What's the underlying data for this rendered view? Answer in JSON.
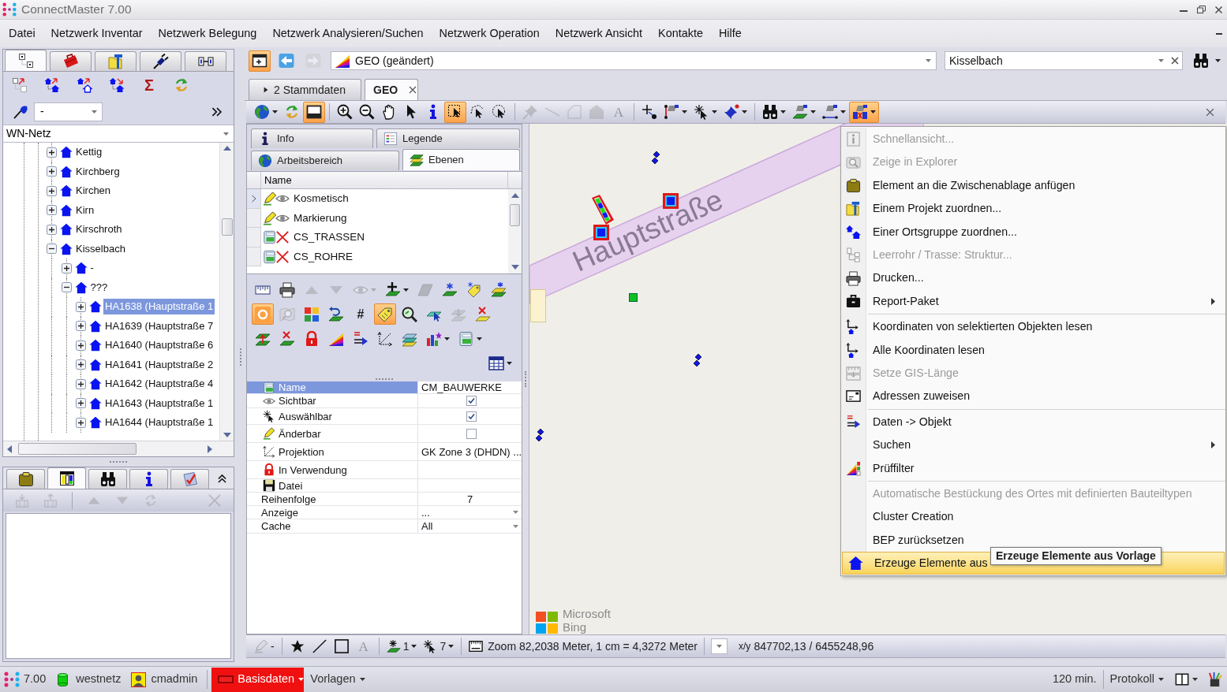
{
  "window": {
    "title": "ConnectMaster 7.00"
  },
  "menu_bar": [
    "Datei",
    "Netzwerk Inventar",
    "Netzwerk Belegung",
    "Netzwerk Analysieren/Suchen",
    "Netzwerk Operation",
    "Netzwerk Ansicht",
    "Kontakte",
    "Hilfe"
  ],
  "left_panel": {
    "tabs": [
      {
        "kind": "tree",
        "selected": true
      },
      {
        "kind": "toolbox",
        "selected": false
      },
      {
        "kind": "project",
        "selected": false
      },
      {
        "kind": "plug",
        "selected": false
      },
      {
        "kind": "connector",
        "selected": false
      }
    ],
    "toolbar": [
      {
        "kind": "treearrow"
      },
      {
        "kind": "housesup"
      },
      {
        "kind": "houseout"
      },
      {
        "kind": "housesdown"
      },
      {
        "kind": "sigma",
        "label": "Σ"
      },
      {
        "kind": "refresh"
      }
    ],
    "filter": {
      "value": "-"
    },
    "network": {
      "value": "WN-Netz"
    },
    "tree": [
      {
        "label": "Kettig",
        "expanded": false,
        "selected": false
      },
      {
        "label": "Kirchberg",
        "expanded": false,
        "selected": false
      },
      {
        "label": "Kirchen",
        "expanded": false,
        "selected": false
      },
      {
        "label": "Kirn",
        "expanded": false,
        "selected": false
      },
      {
        "label": "Kirschroth",
        "expanded": false,
        "selected": false
      },
      {
        "label": "Kisselbach",
        "expanded": true,
        "selected": false,
        "children": [
          {
            "label": "-",
            "expanded": false,
            "selected": false
          },
          {
            "label": "???",
            "expanded": true,
            "selected": false,
            "children": [
              {
                "label": "HA1638 (Hauptstraße 1",
                "expanded": false,
                "selected": true
              },
              {
                "label": "HA1639 (Hauptstraße 7",
                "expanded": false,
                "selected": false
              },
              {
                "label": "HA1640 (Hauptstraße 6",
                "expanded": false,
                "selected": false
              },
              {
                "label": "HA1641 (Hauptstraße 2",
                "expanded": false,
                "selected": false
              },
              {
                "label": "HA1642 (Hauptstraße 4",
                "expanded": false,
                "selected": false
              },
              {
                "label": "HA1643 (Hauptstraße 1",
                "expanded": false,
                "selected": false
              },
              {
                "label": "HA1644 (Hauptstraße 1",
                "expanded": false,
                "selected": false
              }
            ]
          }
        ]
      }
    ]
  },
  "bottom_left_panel": {
    "tabs": [
      {
        "kind": "clipboard",
        "selected": false
      },
      {
        "kind": "table",
        "selected": true
      },
      {
        "kind": "binoculars",
        "selected": false
      },
      {
        "kind": "info",
        "selected": false
      },
      {
        "kind": "checklist",
        "selected": false
      }
    ],
    "toolbar": [
      {
        "kind": "traydown",
        "disabled": true
      },
      {
        "kind": "trayup",
        "disabled": true
      },
      {
        "kind": "separator"
      },
      {
        "kind": "up",
        "disabled": true
      },
      {
        "kind": "down",
        "disabled": true
      },
      {
        "kind": "refreshgrey",
        "disabled": true
      },
      {
        "kind": "closex",
        "disabled": true
      }
    ]
  },
  "top_bar": {
    "buttons": [
      {
        "kind": "windowplus",
        "pressed": true,
        "disabled": false
      },
      {
        "kind": "back",
        "pressed": false,
        "disabled": false
      },
      {
        "kind": "forward",
        "pressed": false,
        "disabled": true
      }
    ],
    "view": {
      "value": "GEO (geändert)"
    },
    "place": {
      "value": "Kisselbach"
    }
  },
  "doc_tabs": [
    {
      "label": "2 Stammdaten",
      "selected": false,
      "closable": false
    },
    {
      "label": "GEO",
      "selected": true,
      "closable": true
    }
  ],
  "map_toolbar": [
    {
      "kind": "globe",
      "pressed": false,
      "disabled": false,
      "dropdown": true
    },
    {
      "kind": "refresh",
      "pressed": false,
      "disabled": false,
      "dropdown": false
    },
    {
      "kind": "window",
      "pressed": true,
      "disabled": false,
      "dropdown": false
    },
    {
      "kind": "separator"
    },
    {
      "kind": "zoomin",
      "pressed": false,
      "disabled": false,
      "dropdown": false
    },
    {
      "kind": "zoomout",
      "pressed": false,
      "disabled": false,
      "dropdown": false
    },
    {
      "kind": "hand",
      "pressed": false,
      "disabled": false,
      "dropdown": false
    },
    {
      "kind": "cursor",
      "pressed": false,
      "disabled": false,
      "dropdown": false
    },
    {
      "kind": "info",
      "pressed": false,
      "disabled": false,
      "dropdown": false
    },
    {
      "kind": "selrect",
      "pressed": true,
      "disabled": false,
      "dropdown": false
    },
    {
      "kind": "sellasso",
      "pressed": false,
      "disabled": false,
      "dropdown": false
    },
    {
      "kind": "selcircle",
      "pressed": false,
      "disabled": false,
      "dropdown": false
    },
    {
      "kind": "separator"
    },
    {
      "kind": "pin",
      "pressed": false,
      "disabled": true,
      "dropdown": false
    },
    {
      "kind": "line",
      "pressed": false,
      "disabled": true,
      "dropdown": false
    },
    {
      "kind": "polyline",
      "pressed": false,
      "disabled": true,
      "dropdown": false
    },
    {
      "kind": "polygon",
      "pressed": false,
      "disabled": true,
      "dropdown": false
    },
    {
      "kind": "letter",
      "label": "A",
      "pressed": false,
      "disabled": true,
      "dropdown": false
    },
    {
      "kind": "separator"
    },
    {
      "kind": "addpoint",
      "pressed": false,
      "disabled": false,
      "dropdown": false
    },
    {
      "kind": "flagline",
      "pressed": false,
      "disabled": false,
      "dropdown": true
    },
    {
      "kind": "sparkle",
      "pressed": false,
      "disabled": false,
      "dropdown": true
    },
    {
      "kind": "pinq",
      "pressed": false,
      "disabled": false,
      "dropdown": true
    },
    {
      "kind": "separator"
    },
    {
      "kind": "binoculars",
      "pressed": false,
      "disabled": false,
      "dropdown": true
    },
    {
      "kind": "layerflag",
      "pressed": false,
      "disabled": false,
      "dropdown": true
    },
    {
      "kind": "lineflag",
      "pressed": false,
      "disabled": false,
      "dropdown": true
    },
    {
      "kind": "crossflag",
      "pressed": true,
      "disabled": false,
      "dropdown": true
    }
  ],
  "layers_panel": {
    "tabs": [
      {
        "label": "Info",
        "kind": "info",
        "selected": false
      },
      {
        "label": "Legende",
        "kind": "legend",
        "selected": false
      },
      {
        "label": "Arbeitsbereich",
        "kind": "globe",
        "selected": false
      },
      {
        "label": "Ebenen",
        "kind": "layers",
        "selected": true
      }
    ],
    "grid": {
      "columns": [
        "Name"
      ],
      "rows": [
        {
          "name": "Kosmetisch",
          "kind": "sketch",
          "visible": true,
          "selected": true
        },
        {
          "name": "Markierung",
          "kind": "sketch",
          "visible": true,
          "selected": false
        },
        {
          "name": "CS_TRASSEN",
          "kind": "database",
          "visible": false,
          "selected": false
        },
        {
          "name": "CS_ROHRE",
          "kind": "database",
          "visible": false,
          "selected": false
        }
      ]
    },
    "toolbar_rows": [
      [
        {
          "kind": "ruler",
          "pressed": false,
          "disabled": false,
          "dropdown": false
        },
        {
          "kind": "printer",
          "pressed": false,
          "disabled": false,
          "dropdown": false
        },
        {
          "kind": "up",
          "pressed": false,
          "disabled": true,
          "dropdown": false
        },
        {
          "kind": "down",
          "pressed": false,
          "disabled": true,
          "dropdown": false
        },
        {
          "kind": "eye",
          "pressed": false,
          "disabled": true,
          "dropdown": true
        },
        {
          "kind": "pluslayer",
          "pressed": false,
          "disabled": false,
          "dropdown": true
        },
        {
          "kind": "layer",
          "pressed": false,
          "disabled": true,
          "dropdown": false
        },
        {
          "kind": "layerstar",
          "pressed": false,
          "disabled": false,
          "dropdown": false
        },
        {
          "kind": "tagstar",
          "pressed": false,
          "disabled": false,
          "dropdown": false
        },
        {
          "kind": "layersstar",
          "pressed": false,
          "disabled": false,
          "dropdown": false
        }
      ],
      [
        {
          "kind": "ring",
          "pressed": true,
          "disabled": false,
          "dropdown": false
        },
        {
          "kind": "mapsearch",
          "pressed": false,
          "disabled": true,
          "dropdown": false
        },
        {
          "kind": "tiles",
          "pressed": false,
          "disabled": false,
          "dropdown": false
        },
        {
          "kind": "undolayer",
          "pressed": false,
          "disabled": false,
          "dropdown": false
        },
        {
          "kind": "hash",
          "label": "#",
          "pressed": false,
          "disabled": false,
          "dropdown": false
        },
        {
          "kind": "tag",
          "pressed": true,
          "disabled": false,
          "dropdown": false
        },
        {
          "kind": "magnifier",
          "pressed": false,
          "disabled": false,
          "dropdown": false
        },
        {
          "kind": "layercursor",
          "pressed": false,
          "disabled": false,
          "dropdown": false
        },
        {
          "kind": "layerdown",
          "pressed": false,
          "disabled": true,
          "dropdown": false
        },
        {
          "kind": "layerx",
          "pressed": false,
          "disabled": false,
          "dropdown": false
        }
      ],
      [
        {
          "kind": "layerup",
          "pressed": false,
          "disabled": false,
          "dropdown": false
        },
        {
          "kind": "layerx2",
          "pressed": false,
          "disabled": false,
          "dropdown": false
        },
        {
          "kind": "lock",
          "pressed": false,
          "disabled": false,
          "dropdown": false
        },
        {
          "kind": "gradient",
          "pressed": false,
          "disabled": false,
          "dropdown": false
        },
        {
          "kind": "cmarrow",
          "pressed": false,
          "disabled": false,
          "dropdown": false
        },
        {
          "kind": "projection",
          "pressed": false,
          "disabled": false,
          "dropdown": false
        },
        {
          "kind": "layerstack",
          "pressed": false,
          "disabled": false,
          "dropdown": false
        },
        {
          "kind": "chart",
          "pressed": false,
          "disabled": false,
          "dropdown": true
        },
        {
          "kind": "db",
          "pressed": false,
          "disabled": false,
          "dropdown": true
        }
      ],
      [
        {
          "kind": "grid",
          "pressed": false,
          "disabled": false,
          "dropdown": true
        }
      ]
    ],
    "properties": [
      {
        "label": "Name",
        "kind": "text",
        "value": "CM_BAUWERKE",
        "selected": true
      },
      {
        "label": "Sichtbar",
        "kind": "checkbox",
        "checked": true,
        "selected": false
      },
      {
        "label": "Auswählbar",
        "kind": "checkbox",
        "checked": true,
        "selected": false
      },
      {
        "label": "Änderbar",
        "kind": "checkbox",
        "checked": false,
        "selected": false
      },
      {
        "label": "Projektion",
        "kind": "text",
        "value": "GK Zone 3 (DHDN) ...",
        "selected": false
      },
      {
        "label": "In Verwendung",
        "kind": "text",
        "selected": false
      },
      {
        "label": "Datei",
        "kind": "text",
        "selected": false
      },
      {
        "label": "Reihenfolge",
        "kind": "number",
        "value": "7",
        "selected": false
      },
      {
        "label": "Anzeige",
        "kind": "dropdown",
        "value": "...",
        "selected": false
      },
      {
        "label": "Cache",
        "kind": "dropdown",
        "value": "All",
        "selected": false
      }
    ]
  },
  "map": {
    "street": "Hauptstraße",
    "markers": [
      {
        "kind": "diamonds",
        "selected": false
      },
      {
        "kind": "cluster",
        "selected": true
      },
      {
        "kind": "square",
        "selected": true
      },
      {
        "kind": "square",
        "selected": true
      },
      {
        "kind": "tag",
        "selected": false
      },
      {
        "kind": "point",
        "selected": false
      },
      {
        "kind": "diamonds",
        "selected": false
      },
      {
        "kind": "diamonds",
        "selected": false
      }
    ],
    "attribution": [
      "Microsoft",
      "Bing"
    ]
  },
  "context_menu": [
    {
      "kind": "item",
      "label": "Schnellansicht...",
      "disabled": true,
      "submenu": false,
      "selected": false
    },
    {
      "kind": "item",
      "label": "Zeige in Explorer",
      "disabled": true,
      "submenu": false,
      "selected": false
    },
    {
      "kind": "item",
      "label": "Element an die Zwischenablage anfügen",
      "disabled": false,
      "submenu": false,
      "selected": false
    },
    {
      "kind": "item",
      "label": "Einem Projekt zuordnen...",
      "disabled": false,
      "submenu": false,
      "selected": false
    },
    {
      "kind": "item",
      "label": "Einer Ortsgruppe zuordnen...",
      "disabled": false,
      "submenu": false,
      "selected": false
    },
    {
      "kind": "item",
      "label": "Leerrohr / Trasse: Struktur...",
      "disabled": true,
      "submenu": false,
      "selected": false
    },
    {
      "kind": "item",
      "label": "Drucken...",
      "disabled": false,
      "submenu": false,
      "selected": false
    },
    {
      "kind": "item",
      "label": "Report-Paket",
      "disabled": false,
      "submenu": true,
      "selected": false
    },
    {
      "kind": "separator"
    },
    {
      "kind": "item",
      "label": "Koordinaten von selektierten Objekten lesen",
      "disabled": false,
      "submenu": false,
      "selected": false
    },
    {
      "kind": "item",
      "label": "Alle Koordinaten lesen",
      "disabled": false,
      "submenu": false,
      "selected": false
    },
    {
      "kind": "item",
      "label": "Setze GIS-Länge",
      "disabled": true,
      "submenu": false,
      "selected": false
    },
    {
      "kind": "item",
      "label": "Adressen zuweisen",
      "disabled": false,
      "submenu": false,
      "selected": false
    },
    {
      "kind": "separator"
    },
    {
      "kind": "item",
      "label": "Daten -> Objekt",
      "disabled": false,
      "submenu": false,
      "selected": false
    },
    {
      "kind": "item",
      "label": "Suchen",
      "disabled": false,
      "submenu": true,
      "selected": false
    },
    {
      "kind": "item",
      "label": "Prüffilter",
      "disabled": false,
      "submenu": false,
      "selected": false
    },
    {
      "kind": "separator"
    },
    {
      "kind": "item",
      "label": "Automatische Bestückung des Ortes mit definierten Bauteiltypen",
      "disabled": true,
      "submenu": false,
      "selected": false
    },
    {
      "kind": "item",
      "label": "Cluster Creation",
      "disabled": false,
      "submenu": false,
      "selected": false
    },
    {
      "kind": "item",
      "label": "BEP zurücksetzen",
      "disabled": false,
      "submenu": false,
      "selected": false
    },
    {
      "kind": "item",
      "label": "Erzeuge Elemente aus",
      "disabled": false,
      "submenu": false,
      "selected": true
    }
  ],
  "tooltip": "Erzeuge Elemente aus Vorlage",
  "map_statusbar": {
    "tools": [
      {
        "kind": "pencil",
        "label": "-",
        "disabled": true,
        "dropdown": false
      },
      {
        "kind": "separator"
      },
      {
        "kind": "star",
        "disabled": false,
        "dropdown": false
      },
      {
        "kind": "lineblack",
        "disabled": false,
        "dropdown": false
      },
      {
        "kind": "rect",
        "disabled": false,
        "dropdown": false
      },
      {
        "kind": "letter",
        "label": "A",
        "disabled": true,
        "dropdown": false
      },
      {
        "kind": "separator"
      },
      {
        "kind": "layerspark",
        "label": "1",
        "disabled": false,
        "dropdown": true
      },
      {
        "kind": "sparkle",
        "label": "7",
        "disabled": false,
        "dropdown": true
      },
      {
        "kind": "separator"
      }
    ],
    "zoom": "Zoom 82,2038 Meter, 1 cm = 4,3272 Meter",
    "coords_label": "x/y",
    "coords": "847702,13 / 6455248,96"
  },
  "status_bar": {
    "version": "7.00",
    "database": "westnetz",
    "user": "cmadmin",
    "mode": "Basisdaten",
    "templates": "Vorlagen",
    "timeout": "120 min.",
    "log": "Protokoll"
  }
}
